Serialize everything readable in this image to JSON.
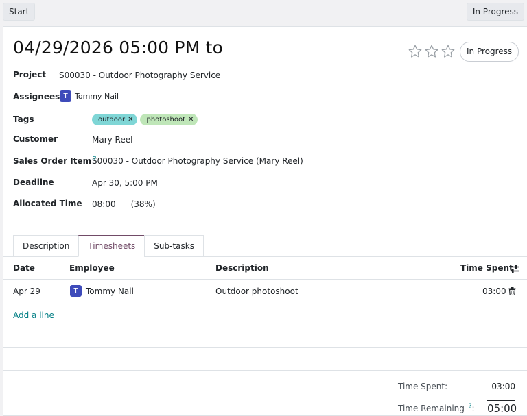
{
  "toolbar": {
    "start_label": "Start",
    "stage_label": "In Progress"
  },
  "task": {
    "title": "04/29/2026 05:00 PM to",
    "priority_stars": 3,
    "stage_pill": "In Progress"
  },
  "fields": {
    "project": {
      "label": "Project",
      "value": "S00030 - Outdoor Photography Service"
    },
    "assignees": {
      "label": "Assignees",
      "avatar_letter": "T",
      "name": "Tommy Nail"
    },
    "tags": {
      "label": "Tags",
      "items": [
        {
          "text": "outdoor",
          "color": "#7fd6d6"
        },
        {
          "text": "photoshoot",
          "color": "#bfe6b8"
        }
      ]
    },
    "customer": {
      "label": "Customer",
      "value": "Mary Reel"
    },
    "sales_order_item": {
      "label": "Sales Order Item",
      "help": "?",
      "value": "S00030 - Outdoor Photography Service (Mary Reel)"
    },
    "deadline": {
      "label": "Deadline",
      "value": "Apr 30, 5:00 PM"
    },
    "allocated_time": {
      "label": "Allocated Time",
      "value": "08:00",
      "percent": "(38%)"
    }
  },
  "tabs": [
    {
      "label": "Description",
      "active": false
    },
    {
      "label": "Timesheets",
      "active": true
    },
    {
      "label": "Sub-tasks",
      "active": false
    }
  ],
  "timesheets": {
    "columns": [
      "Date",
      "Employee",
      "Description",
      "Time Spent"
    ],
    "rows": [
      {
        "date": "Apr 29",
        "employee_initial": "T",
        "employee": "Tommy Nail",
        "description": "Outdoor photoshoot",
        "time_spent": "03:00"
      }
    ],
    "add_line": "Add a line"
  },
  "totals": {
    "time_spent_label": "Time Spent:",
    "time_spent_value": "03:00",
    "time_remaining_label": "Time Remaining",
    "time_remaining_help": "?",
    "time_remaining_value": "05:00"
  },
  "colors": {
    "accent": "#714b67",
    "link": "#017e84",
    "avatar": "#3e4bba"
  }
}
